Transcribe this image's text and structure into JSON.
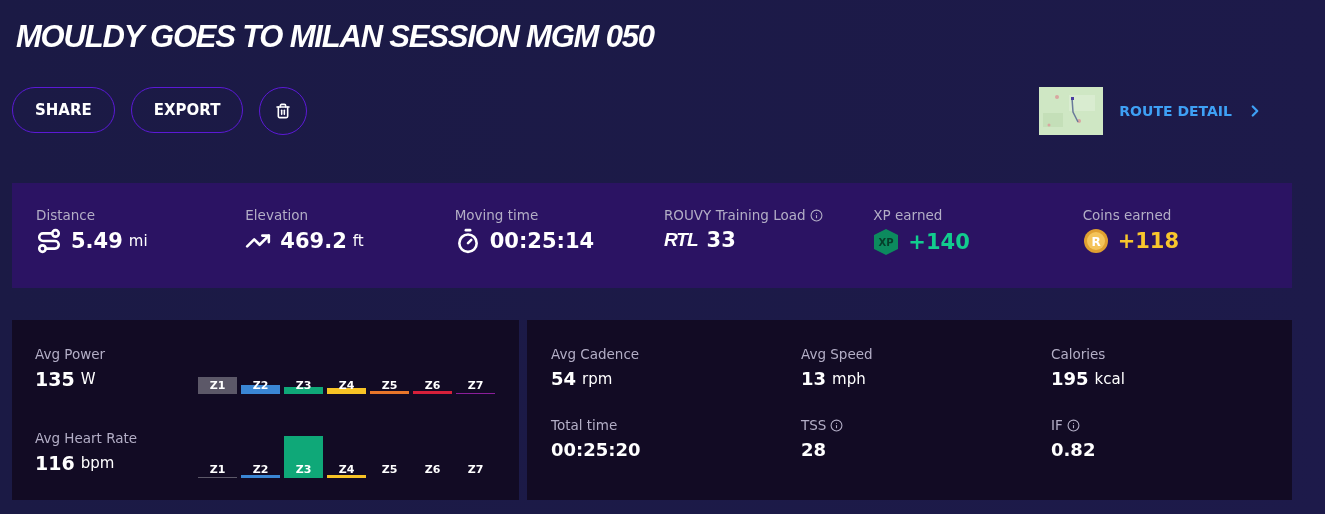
{
  "title": "MOULDY GOES TO MILAN SESSION MGM 050",
  "actions": [
    {
      "kind": "text",
      "label": "SHARE"
    },
    {
      "kind": "text",
      "label": "EXPORT"
    },
    {
      "kind": "delete"
    }
  ],
  "route": {
    "link": "ROUTE DETAIL"
  },
  "summary": [
    {
      "kind": "distance",
      "label": "Distance",
      "value": "5.49",
      "unit": "mi"
    },
    {
      "kind": "elevation",
      "label": "Elevation",
      "value": "469.2",
      "unit": "ft"
    },
    {
      "kind": "time",
      "label": "Moving time",
      "value": "00:25:14"
    },
    {
      "kind": "rtl",
      "label": "ROUVY Training Load",
      "logo": "RTL",
      "value": "33",
      "info": true
    },
    {
      "kind": "xp",
      "label": "XP earned",
      "badge": "XP",
      "value": "+140",
      "color": "#12cc8e"
    },
    {
      "kind": "coins",
      "label": "Coins earned",
      "badge": "R",
      "value": "+118",
      "color": "#f8c62c"
    }
  ],
  "zones": [
    {
      "label": "Avg Power",
      "value": "135",
      "unit": "W",
      "bars": [
        {
          "label": "Z1",
          "color": "#5c5868"
        },
        {
          "label": "Z2",
          "color": "#3a86d4"
        },
        {
          "label": "Z3",
          "color": "#0fa878"
        },
        {
          "label": "Z4",
          "color": "#f7c325"
        },
        {
          "label": "Z5",
          "color": "#e8762a"
        },
        {
          "label": "Z6",
          "color": "#d6203a"
        },
        {
          "label": "Z7",
          "color": "#8a1e9a"
        }
      ]
    },
    {
      "label": "Avg Heart Rate",
      "value": "116",
      "unit": "bpm",
      "bars": [
        {
          "label": "Z1",
          "color": "#5c5868"
        },
        {
          "label": "Z2",
          "color": "#3a86d4"
        },
        {
          "label": "Z3",
          "color": "#0fa878"
        },
        {
          "label": "Z4",
          "color": "#f7c325"
        },
        {
          "label": "Z5"
        },
        {
          "label": "Z6"
        },
        {
          "label": "Z7"
        }
      ]
    }
  ],
  "metrics": [
    {
      "label": "Avg Cadence",
      "value": "54",
      "unit": "rpm"
    },
    {
      "label": "Avg Speed",
      "value": "13",
      "unit": "mph"
    },
    {
      "label": "Calories",
      "value": "195",
      "unit": "kcal"
    },
    {
      "label": "Total time",
      "value": "00:25:20"
    },
    {
      "label": "TSS",
      "value": "28",
      "info": true
    },
    {
      "label": "IF",
      "value": "0.82",
      "info": true
    }
  ]
}
